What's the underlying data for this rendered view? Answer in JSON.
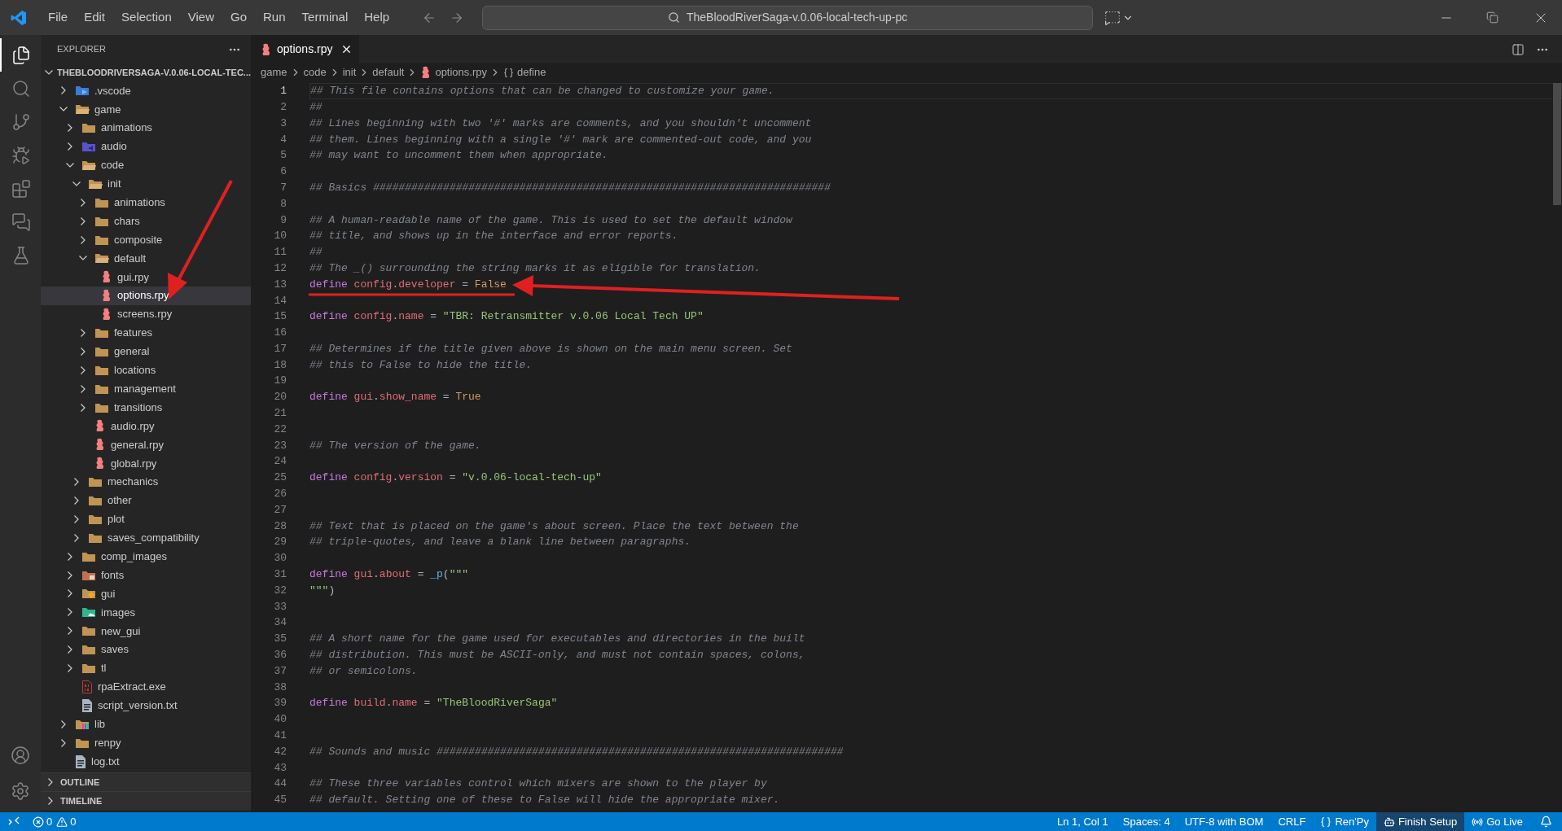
{
  "menu": [
    "File",
    "Edit",
    "Selection",
    "View",
    "Go",
    "Run",
    "Terminal",
    "Help"
  ],
  "command_center": {
    "text": "TheBloodRiverSaga-v.0.06-local-tech-up-pc"
  },
  "activity_bar": [
    {
      "kind": "files",
      "selected": true
    },
    {
      "kind": "search",
      "selected": false
    },
    {
      "kind": "source",
      "selected": false
    },
    {
      "kind": "debug",
      "selected": false
    },
    {
      "kind": "extensions",
      "selected": false
    },
    {
      "kind": "chat",
      "selected": false
    },
    {
      "kind": "testing",
      "selected": false
    }
  ],
  "sidebar": {
    "title": "EXPLORER",
    "project": "THEBLOODRIVERSAGA-V.0.06-LOCAL-TEC...",
    "tree": [
      {
        "label": ".vscode",
        "kind": "vscode",
        "expanded": false,
        "selected": false
      },
      {
        "label": "game",
        "kind": "folder",
        "expanded": true,
        "selected": false,
        "children": [
          {
            "label": "animations",
            "kind": "folder",
            "expanded": false,
            "selected": false
          },
          {
            "label": "audio",
            "kind": "audio",
            "expanded": false,
            "selected": false
          },
          {
            "label": "code",
            "kind": "folder",
            "expanded": true,
            "selected": false,
            "children": [
              {
                "label": "init",
                "kind": "folder",
                "expanded": true,
                "selected": false,
                "children": [
                  {
                    "label": "animations",
                    "kind": "folder",
                    "expanded": false,
                    "selected": false
                  },
                  {
                    "label": "chars",
                    "kind": "folder",
                    "expanded": false,
                    "selected": false
                  },
                  {
                    "label": "composite",
                    "kind": "folder",
                    "expanded": false,
                    "selected": false
                  },
                  {
                    "label": "default",
                    "kind": "folder",
                    "expanded": true,
                    "selected": false,
                    "children": [
                      {
                        "label": "gui.rpy",
                        "kind": "renpy",
                        "selected": false
                      },
                      {
                        "label": "options.rpy",
                        "kind": "renpy",
                        "selected": true
                      },
                      {
                        "label": "screens.rpy",
                        "kind": "renpy",
                        "selected": false
                      }
                    ]
                  },
                  {
                    "label": "features",
                    "kind": "folder",
                    "expanded": false,
                    "selected": false
                  },
                  {
                    "label": "general",
                    "kind": "folder",
                    "expanded": false,
                    "selected": false
                  },
                  {
                    "label": "locations",
                    "kind": "folder",
                    "expanded": false,
                    "selected": false
                  },
                  {
                    "label": "management",
                    "kind": "folder",
                    "expanded": false,
                    "selected": false
                  },
                  {
                    "label": "transitions",
                    "kind": "folder",
                    "expanded": false,
                    "selected": false
                  },
                  {
                    "label": "audio.rpy",
                    "kind": "renpy",
                    "selected": false
                  },
                  {
                    "label": "general.rpy",
                    "kind": "renpy",
                    "selected": false
                  },
                  {
                    "label": "global.rpy",
                    "kind": "renpy",
                    "selected": false
                  }
                ]
              },
              {
                "label": "mechanics",
                "kind": "folder",
                "expanded": false,
                "selected": false
              },
              {
                "label": "other",
                "kind": "folder",
                "expanded": false,
                "selected": false
              },
              {
                "label": "plot",
                "kind": "folder",
                "expanded": false,
                "selected": false
              },
              {
                "label": "saves_compatibility",
                "kind": "folder",
                "expanded": false,
                "selected": false
              }
            ]
          },
          {
            "label": "comp_images",
            "kind": "folder",
            "expanded": false,
            "selected": false
          },
          {
            "label": "fonts",
            "kind": "fonts",
            "expanded": false,
            "selected": false
          },
          {
            "label": "gui",
            "kind": "gui",
            "expanded": false,
            "selected": false
          },
          {
            "label": "images",
            "kind": "images",
            "expanded": false,
            "selected": false
          },
          {
            "label": "new_gui",
            "kind": "folder",
            "expanded": false,
            "selected": false
          },
          {
            "label": "saves",
            "kind": "folder",
            "expanded": false,
            "selected": false
          },
          {
            "label": "tl",
            "kind": "folder",
            "expanded": false,
            "selected": false
          },
          {
            "label": "rpaExtract.exe",
            "kind": "binary",
            "selected": false
          },
          {
            "label": "script_version.txt",
            "kind": "text",
            "selected": false
          }
        ]
      },
      {
        "label": "lib",
        "kind": "lib",
        "expanded": false,
        "selected": false
      },
      {
        "label": "renpy",
        "kind": "folder",
        "expanded": false,
        "selected": false
      },
      {
        "label": "log.txt",
        "kind": "text",
        "selected": false
      }
    ],
    "sections": [
      "OUTLINE",
      "TIMELINE"
    ]
  },
  "tabs": [
    {
      "label": "options.rpy",
      "selected": true
    }
  ],
  "breadcrumb": [
    {
      "kind": "folder",
      "text": "game"
    },
    {
      "kind": "folder",
      "text": "code"
    },
    {
      "kind": "folder",
      "text": "init"
    },
    {
      "kind": "folder",
      "text": "default"
    },
    {
      "kind": "file",
      "text": "options.rpy"
    },
    {
      "kind": "symbol",
      "text": "define"
    }
  ],
  "editor": {
    "lines": [
      {
        "number": "1",
        "tokens": [
          {
            "kind": "comment",
            "text": "## This file contains options that can be changed to customize your game."
          }
        ]
      },
      {
        "number": "2",
        "tokens": [
          {
            "kind": "comment",
            "text": "##"
          }
        ]
      },
      {
        "number": "3",
        "tokens": [
          {
            "kind": "comment",
            "text": "## Lines beginning with two '#' marks are comments, and you shouldn't uncomment"
          }
        ]
      },
      {
        "number": "4",
        "tokens": [
          {
            "kind": "comment",
            "text": "## them. Lines beginning with a single '#' mark are commented-out code, and you"
          }
        ]
      },
      {
        "number": "5",
        "tokens": [
          {
            "kind": "comment",
            "text": "## may want to uncomment them when appropriate."
          }
        ]
      },
      {
        "number": "6"
      },
      {
        "number": "7",
        "tokens": [
          {
            "kind": "comment",
            "text": "## Basics ########################################################################"
          }
        ]
      },
      {
        "number": "8"
      },
      {
        "number": "9",
        "tokens": [
          {
            "kind": "comment",
            "text": "## A human-readable name of the game. This is used to set the default window"
          }
        ]
      },
      {
        "number": "10",
        "tokens": [
          {
            "kind": "comment",
            "text": "## title, and shows up in the interface and error reports."
          }
        ]
      },
      {
        "number": "11",
        "tokens": [
          {
            "kind": "comment",
            "text": "##"
          }
        ]
      },
      {
        "number": "12",
        "tokens": [
          {
            "kind": "comment",
            "text": "## The _() surrounding the string marks it as eligible for translation."
          }
        ]
      },
      {
        "number": "13",
        "tokens": [
          {
            "kind": "keyword",
            "text": "define "
          },
          {
            "kind": "variable",
            "text": "config"
          },
          {
            "kind": "plain",
            "text": "."
          },
          {
            "kind": "variable",
            "text": "developer"
          },
          {
            "kind": "plain",
            "text": " = "
          },
          {
            "kind": "constant",
            "text": "False"
          }
        ]
      },
      {
        "number": "14"
      },
      {
        "number": "15",
        "tokens": [
          {
            "kind": "keyword",
            "text": "define "
          },
          {
            "kind": "variable",
            "text": "config"
          },
          {
            "kind": "plain",
            "text": "."
          },
          {
            "kind": "variable",
            "text": "name"
          },
          {
            "kind": "plain",
            "text": " = "
          },
          {
            "kind": "string",
            "text": "\"TBR: Retransmitter v.0.06 Local Tech UP\""
          }
        ]
      },
      {
        "number": "16"
      },
      {
        "number": "17",
        "tokens": [
          {
            "kind": "comment",
            "text": "## Determines if the title given above is shown on the main menu screen. Set"
          }
        ]
      },
      {
        "number": "18",
        "tokens": [
          {
            "kind": "comment",
            "text": "## this to False to hide the title."
          }
        ]
      },
      {
        "number": "19"
      },
      {
        "number": "20",
        "tokens": [
          {
            "kind": "keyword",
            "text": "define "
          },
          {
            "kind": "variable",
            "text": "gui"
          },
          {
            "kind": "plain",
            "text": "."
          },
          {
            "kind": "variable",
            "text": "show_name"
          },
          {
            "kind": "plain",
            "text": " = "
          },
          {
            "kind": "constant",
            "text": "True"
          }
        ]
      },
      {
        "number": "21"
      },
      {
        "number": "22"
      },
      {
        "number": "23",
        "tokens": [
          {
            "kind": "comment",
            "text": "## The version of the game."
          }
        ]
      },
      {
        "number": "24"
      },
      {
        "number": "25",
        "tokens": [
          {
            "kind": "keyword",
            "text": "define "
          },
          {
            "kind": "variable",
            "text": "config"
          },
          {
            "kind": "plain",
            "text": "."
          },
          {
            "kind": "variable",
            "text": "version"
          },
          {
            "kind": "plain",
            "text": " = "
          },
          {
            "kind": "string",
            "text": "\"v.0.06-local-tech-up\""
          }
        ]
      },
      {
        "number": "26"
      },
      {
        "number": "27"
      },
      {
        "number": "28",
        "tokens": [
          {
            "kind": "comment",
            "text": "## Text that is placed on the game's about screen. Place the text between the"
          }
        ]
      },
      {
        "number": "29",
        "tokens": [
          {
            "kind": "comment",
            "text": "## triple-quotes, and leave a blank line between paragraphs."
          }
        ]
      },
      {
        "number": "30"
      },
      {
        "number": "31",
        "tokens": [
          {
            "kind": "keyword",
            "text": "define "
          },
          {
            "kind": "variable",
            "text": "gui"
          },
          {
            "kind": "plain",
            "text": "."
          },
          {
            "kind": "variable",
            "text": "about"
          },
          {
            "kind": "plain",
            "text": " = "
          },
          {
            "kind": "function",
            "text": "_p"
          },
          {
            "kind": "plain",
            "text": "("
          },
          {
            "kind": "string",
            "text": "\"\"\""
          }
        ]
      },
      {
        "number": "32",
        "tokens": [
          {
            "kind": "string",
            "text": "\"\"\""
          },
          {
            "kind": "plain",
            "text": ")"
          }
        ]
      },
      {
        "number": "33"
      },
      {
        "number": "34"
      },
      {
        "number": "35",
        "tokens": [
          {
            "kind": "comment",
            "text": "## A short name for the game used for executables and directories in the built"
          }
        ]
      },
      {
        "number": "36",
        "tokens": [
          {
            "kind": "comment",
            "text": "## distribution. This must be ASCII-only, and must not contain spaces, colons,"
          }
        ]
      },
      {
        "number": "37",
        "tokens": [
          {
            "kind": "comment",
            "text": "## or semicolons."
          }
        ]
      },
      {
        "number": "38"
      },
      {
        "number": "39",
        "tokens": [
          {
            "kind": "keyword",
            "text": "define "
          },
          {
            "kind": "variable",
            "text": "build"
          },
          {
            "kind": "plain",
            "text": "."
          },
          {
            "kind": "variable",
            "text": "name"
          },
          {
            "kind": "plain",
            "text": " = "
          },
          {
            "kind": "string",
            "text": "\"TheBloodRiverSaga\""
          }
        ]
      },
      {
        "number": "40"
      },
      {
        "number": "41"
      },
      {
        "number": "42",
        "tokens": [
          {
            "kind": "comment",
            "text": "## Sounds and music ################################################################"
          }
        ]
      },
      {
        "number": "43"
      },
      {
        "number": "44",
        "tokens": [
          {
            "kind": "comment",
            "text": "## These three variables control which mixers are shown to the player by"
          }
        ]
      },
      {
        "number": "45",
        "tokens": [
          {
            "kind": "comment",
            "text": "## default. Setting one of these to False will hide the appropriate mixer."
          }
        ]
      }
    ]
  },
  "status_bar": {
    "errors": "0",
    "warnings": "0",
    "items": [
      {
        "kind": "plain",
        "text": "Ln 1, Col 1",
        "highlighted": false
      },
      {
        "kind": "plain",
        "text": "Spaces: 4",
        "highlighted": false
      },
      {
        "kind": "plain",
        "text": "UTF-8 with BOM",
        "highlighted": false
      },
      {
        "kind": "plain",
        "text": "CRLF",
        "highlighted": false
      },
      {
        "kind": "language",
        "text": "Ren'Py",
        "highlighted": false
      },
      {
        "kind": "setup",
        "text": "Finish Setup",
        "highlighted": true
      },
      {
        "kind": "live",
        "text": "Go Live",
        "highlighted": false
      }
    ]
  }
}
